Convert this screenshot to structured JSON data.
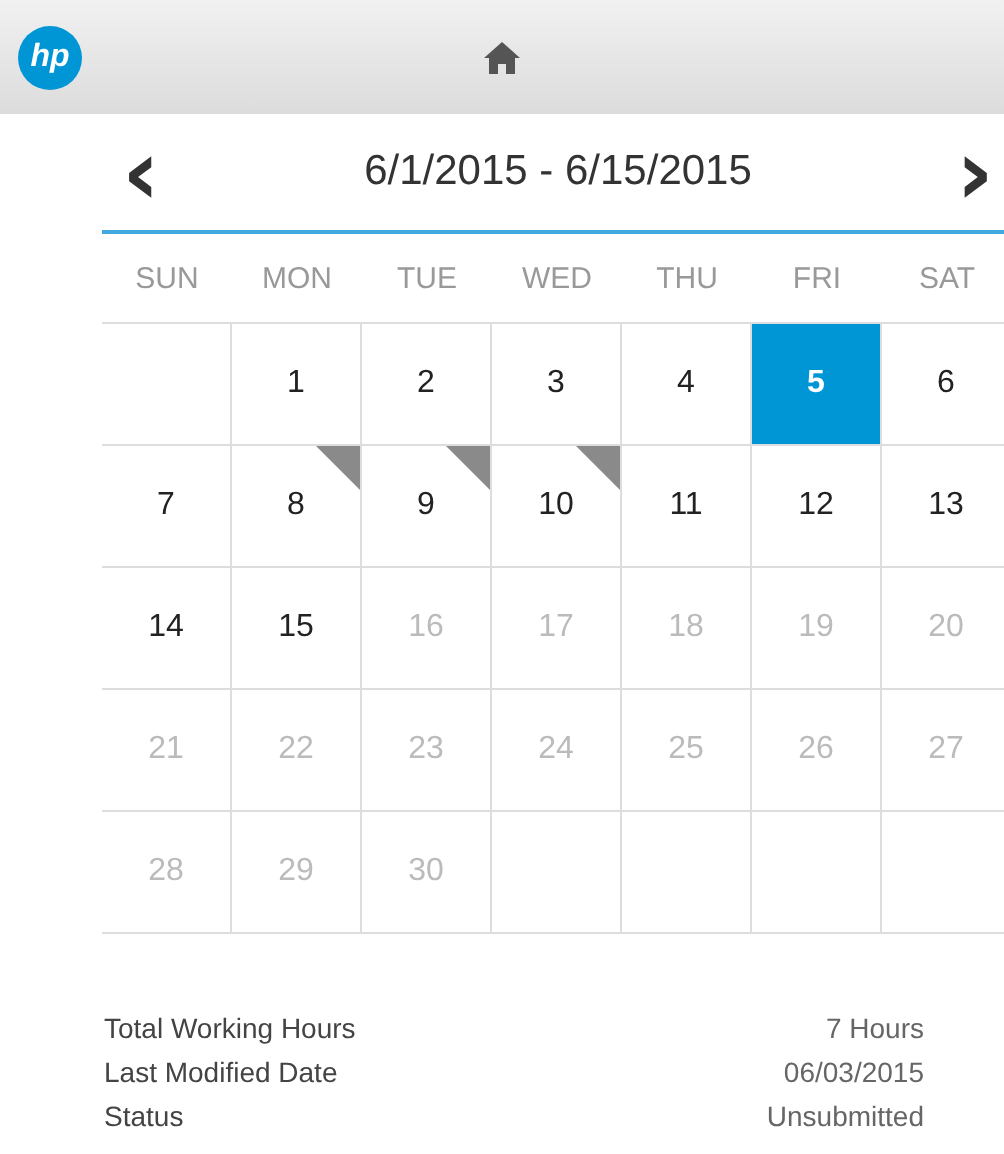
{
  "header": {
    "logo": "hp"
  },
  "range": {
    "title": "6/1/2015 - 6/15/2015",
    "prev": "‹",
    "next": "›"
  },
  "weekdays": [
    "SUN",
    "MON",
    "TUE",
    "WED",
    "THU",
    "FRI",
    "SAT"
  ],
  "weeks": [
    [
      {
        "kind": "blank"
      },
      {
        "kind": "day",
        "day": "1",
        "in_range": true,
        "selected": false,
        "flagged": false
      },
      {
        "kind": "day",
        "day": "2",
        "in_range": true,
        "selected": false,
        "flagged": false
      },
      {
        "kind": "day",
        "day": "3",
        "in_range": true,
        "selected": false,
        "flagged": false
      },
      {
        "kind": "day",
        "day": "4",
        "in_range": true,
        "selected": false,
        "flagged": false
      },
      {
        "kind": "day",
        "day": "5",
        "in_range": true,
        "selected": true,
        "flagged": false
      },
      {
        "kind": "day",
        "day": "6",
        "in_range": true,
        "selected": false,
        "flagged": false
      }
    ],
    [
      {
        "kind": "day",
        "day": "7",
        "in_range": true,
        "selected": false,
        "flagged": false
      },
      {
        "kind": "day",
        "day": "8",
        "in_range": true,
        "selected": false,
        "flagged": true
      },
      {
        "kind": "day",
        "day": "9",
        "in_range": true,
        "selected": false,
        "flagged": true
      },
      {
        "kind": "day",
        "day": "10",
        "in_range": true,
        "selected": false,
        "flagged": true
      },
      {
        "kind": "day",
        "day": "11",
        "in_range": true,
        "selected": false,
        "flagged": false
      },
      {
        "kind": "day",
        "day": "12",
        "in_range": true,
        "selected": false,
        "flagged": false
      },
      {
        "kind": "day",
        "day": "13",
        "in_range": true,
        "selected": false,
        "flagged": false
      }
    ],
    [
      {
        "kind": "day",
        "day": "14",
        "in_range": true,
        "selected": false,
        "flagged": false
      },
      {
        "kind": "day",
        "day": "15",
        "in_range": true,
        "selected": false,
        "flagged": false
      },
      {
        "kind": "day",
        "day": "16",
        "in_range": false,
        "selected": false,
        "flagged": false
      },
      {
        "kind": "day",
        "day": "17",
        "in_range": false,
        "selected": false,
        "flagged": false
      },
      {
        "kind": "day",
        "day": "18",
        "in_range": false,
        "selected": false,
        "flagged": false
      },
      {
        "kind": "day",
        "day": "19",
        "in_range": false,
        "selected": false,
        "flagged": false
      },
      {
        "kind": "day",
        "day": "20",
        "in_range": false,
        "selected": false,
        "flagged": false
      }
    ],
    [
      {
        "kind": "day",
        "day": "21",
        "in_range": false,
        "selected": false,
        "flagged": false
      },
      {
        "kind": "day",
        "day": "22",
        "in_range": false,
        "selected": false,
        "flagged": false
      },
      {
        "kind": "day",
        "day": "23",
        "in_range": false,
        "selected": false,
        "flagged": false
      },
      {
        "kind": "day",
        "day": "24",
        "in_range": false,
        "selected": false,
        "flagged": false
      },
      {
        "kind": "day",
        "day": "25",
        "in_range": false,
        "selected": false,
        "flagged": false
      },
      {
        "kind": "day",
        "day": "26",
        "in_range": false,
        "selected": false,
        "flagged": false
      },
      {
        "kind": "day",
        "day": "27",
        "in_range": false,
        "selected": false,
        "flagged": false
      }
    ],
    [
      {
        "kind": "day",
        "day": "28",
        "in_range": false,
        "selected": false,
        "flagged": false
      },
      {
        "kind": "day",
        "day": "29",
        "in_range": false,
        "selected": false,
        "flagged": false
      },
      {
        "kind": "day",
        "day": "30",
        "in_range": false,
        "selected": false,
        "flagged": false
      },
      {
        "kind": "blank"
      },
      {
        "kind": "blank"
      },
      {
        "kind": "blank"
      },
      {
        "kind": "blank"
      }
    ]
  ],
  "summary": [
    {
      "label": "Total Working Hours",
      "value": "7 Hours"
    },
    {
      "label": "Last Modified Date",
      "value": "06/03/2015"
    },
    {
      "label": "Status",
      "value": "Unsubmitted"
    }
  ]
}
